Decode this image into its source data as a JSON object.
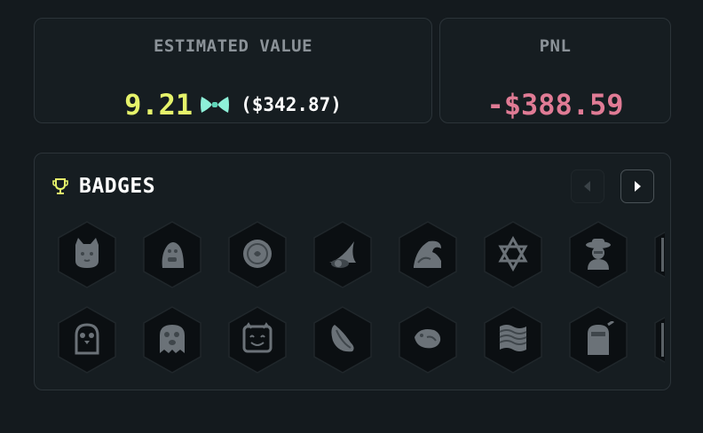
{
  "estimated_value": {
    "label": "ESTIMATED VALUE",
    "amount": "9.21",
    "token_icon": "bowtie-token-icon",
    "usd": "($342.87)",
    "accent_color": "#e6f36b",
    "token_color": "#8ef0d8"
  },
  "pnl": {
    "label": "PNL",
    "value": "-$388.59",
    "color": "#e07b95"
  },
  "badges": {
    "title": "BADGES",
    "trophy_icon": "trophy-icon",
    "trophy_color": "#e6f36b",
    "prev_icon": "chevron-left-icon",
    "next_icon": "chevron-right-icon",
    "rows": [
      [
        "cat-face-badge",
        "gorilla-badge",
        "coin-badge",
        "wizard-hat-badge",
        "wave-badge",
        "star-of-david-badge",
        "detective-badge"
      ],
      [
        "penguin-badge",
        "ghost-badge",
        "block-smile-badge",
        "feather-badge",
        "fish-badge",
        "rainbow-flag-badge",
        "ninja-badge"
      ]
    ]
  }
}
